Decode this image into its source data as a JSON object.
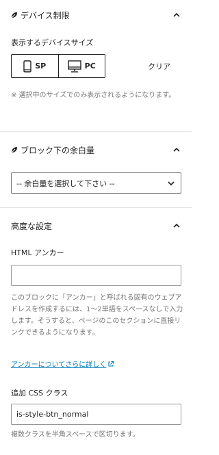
{
  "device_panel": {
    "title": "デバイス制限",
    "size_label": "表示するデバイスサイズ",
    "sp_label": "SP",
    "pc_label": "PC",
    "clear_label": "クリア",
    "help": "※ 選択中のサイズでのみ表示されるようになります。"
  },
  "margin_panel": {
    "title": "ブロック下の余白量",
    "select_value": "-- 余白量を選択して下さい --"
  },
  "advanced_panel": {
    "title": "高度な設定",
    "anchor_label": "HTML アンカー",
    "anchor_value": "",
    "anchor_help": "このブロックに「アンカー」と呼ばれる固有のウェブアドレスを作成するには、1〜2単語をスペースなしで入力します。そうすると、ページのこのセクションに直接リンクできるようになります。",
    "anchor_link": "アンカーについてさらに詳しく",
    "css_label": "追加 CSS クラス",
    "css_value": "is-style-btn_normal",
    "css_help": "複数クラスを半角スペースで区切ります。"
  },
  "colors": {
    "text": "#1e1e1e",
    "muted": "#757575",
    "link": "#007cba",
    "divider": "#e0e0e0"
  }
}
